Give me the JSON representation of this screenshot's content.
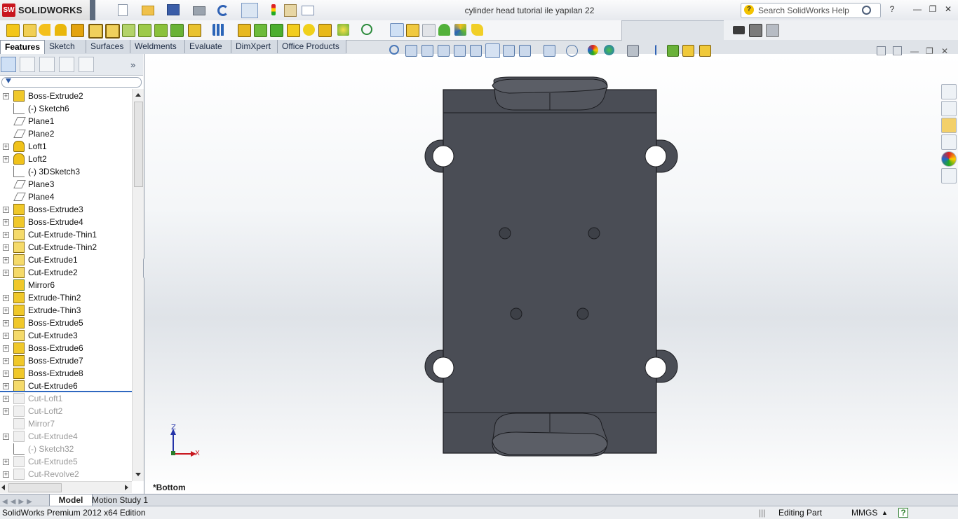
{
  "app": {
    "brand": "SOLIDWORKS",
    "document_title": "cylinder head tutorial ile yapılan 22",
    "search_placeholder": "Search SolidWorks Help",
    "help_label": "?"
  },
  "tabs": [
    {
      "label": "Features",
      "active": true
    },
    {
      "label": "Sketch"
    },
    {
      "label": "Surfaces"
    },
    {
      "label": "Weldments"
    },
    {
      "label": "Evaluate"
    },
    {
      "label": "DimXpert"
    },
    {
      "label": "Office Products"
    }
  ],
  "feature_tree": [
    {
      "label": "Boss-Extrude2",
      "icon": "boss-extrude-icon",
      "expandable": true
    },
    {
      "label": "(-) Sketch6",
      "icon": "sketch-icon",
      "expandable": false
    },
    {
      "label": "Plane1",
      "icon": "plane-icon",
      "expandable": false
    },
    {
      "label": "Plane2",
      "icon": "plane-icon",
      "expandable": false
    },
    {
      "label": "Loft1",
      "icon": "loft-icon",
      "expandable": true
    },
    {
      "label": "Loft2",
      "icon": "loft-icon",
      "expandable": true
    },
    {
      "label": "(-) 3DSketch3",
      "icon": "3dsketch-icon",
      "expandable": false
    },
    {
      "label": "Plane3",
      "icon": "plane-icon",
      "expandable": false
    },
    {
      "label": "Plane4",
      "icon": "plane-icon",
      "expandable": false
    },
    {
      "label": "Boss-Extrude3",
      "icon": "boss-extrude-icon",
      "expandable": true
    },
    {
      "label": "Boss-Extrude4",
      "icon": "boss-extrude-icon",
      "expandable": true
    },
    {
      "label": "Cut-Extrude-Thin1",
      "icon": "cut-extrude-icon",
      "expandable": true
    },
    {
      "label": "Cut-Extrude-Thin2",
      "icon": "cut-extrude-icon",
      "expandable": true
    },
    {
      "label": "Cut-Extrude1",
      "icon": "cut-extrude-icon",
      "expandable": true
    },
    {
      "label": "Cut-Extrude2",
      "icon": "cut-extrude-icon",
      "expandable": true
    },
    {
      "label": "Mirror6",
      "icon": "mirror-icon",
      "expandable": false
    },
    {
      "label": "Extrude-Thin2",
      "icon": "boss-extrude-icon",
      "expandable": true
    },
    {
      "label": "Extrude-Thin3",
      "icon": "boss-extrude-icon",
      "expandable": true
    },
    {
      "label": "Boss-Extrude5",
      "icon": "boss-extrude-icon",
      "expandable": true
    },
    {
      "label": "Cut-Extrude3",
      "icon": "cut-extrude-icon",
      "expandable": true
    },
    {
      "label": "Boss-Extrude6",
      "icon": "boss-extrude-icon",
      "expandable": true
    },
    {
      "label": "Boss-Extrude7",
      "icon": "boss-extrude-icon",
      "expandable": true
    },
    {
      "label": "Boss-Extrude8",
      "icon": "boss-extrude-icon",
      "expandable": true
    },
    {
      "label": "Cut-Extrude6",
      "icon": "cut-extrude-icon",
      "expandable": true
    },
    {
      "label": "Cut-Loft1",
      "icon": "cut-loft-icon",
      "expandable": true,
      "rolled_back": true
    },
    {
      "label": "Cut-Loft2",
      "icon": "cut-loft-icon",
      "expandable": true,
      "rolled_back": true
    },
    {
      "label": "Mirror7",
      "icon": "mirror-icon",
      "expandable": false,
      "rolled_back": true
    },
    {
      "label": "Cut-Extrude4",
      "icon": "cut-extrude-icon",
      "expandable": true,
      "rolled_back": true
    },
    {
      "label": "(-) Sketch32",
      "icon": "sketch-icon",
      "expandable": false,
      "rolled_back": true
    },
    {
      "label": "Cut-Extrude5",
      "icon": "cut-extrude-icon",
      "expandable": true,
      "rolled_back": true
    },
    {
      "label": "Cut-Revolve2",
      "icon": "cut-revolve-icon",
      "expandable": true,
      "rolled_back": true
    }
  ],
  "viewport": {
    "view_name": "*Bottom",
    "triad": {
      "z_label": "Z",
      "x_label": "X"
    }
  },
  "bottom_tabs": [
    {
      "label": "Model",
      "active": true
    },
    {
      "label": "Motion Study 1"
    }
  ],
  "status": {
    "edition": "SolidWorks Premium 2012 x64 Edition",
    "mode": "Editing Part",
    "units": "MMGS",
    "help": "?"
  },
  "colors": {
    "part_fill": "#4a4d55",
    "part_edge": "#1b1c20",
    "accent_red": "#c8161e"
  }
}
